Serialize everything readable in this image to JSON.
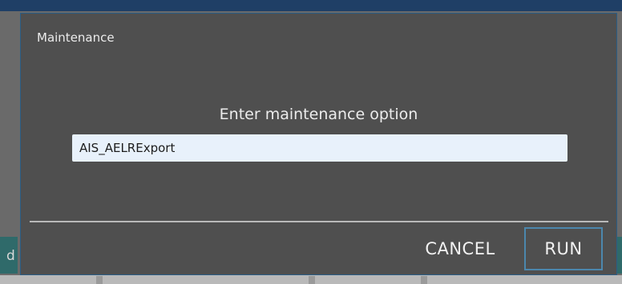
{
  "dialog": {
    "title": "Maintenance",
    "prompt": "Enter maintenance option",
    "option_input_value": "AIS_AELRExport",
    "cancel_label": "CANCEL",
    "run_label": "RUN"
  },
  "background": {
    "partial_text": "d"
  },
  "colors": {
    "dialog_bg": "#4f4f4f",
    "input_bg": "#e8f1fb",
    "accent_border": "#4c87ad",
    "header_bar": "#1f3f66"
  }
}
